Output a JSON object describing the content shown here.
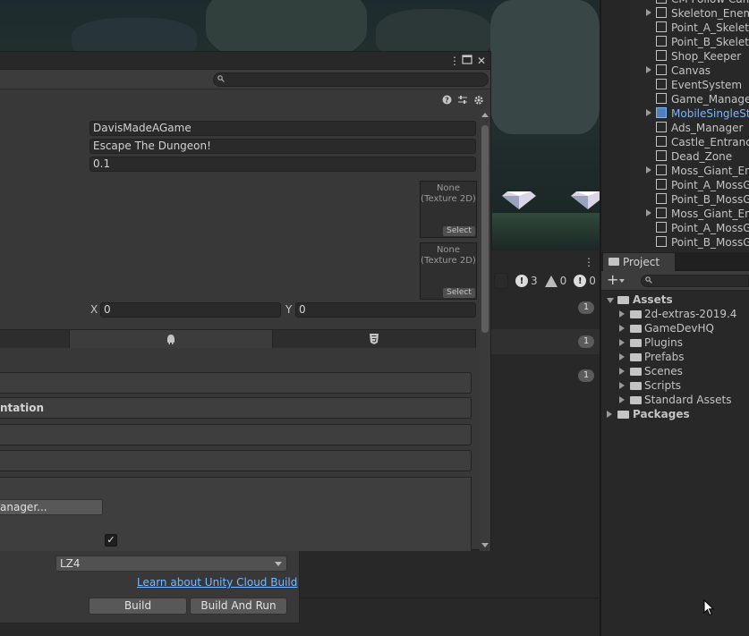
{
  "dialog": {
    "company_name": "DavisMadeAGame",
    "product_name": "Escape The Dungeon!",
    "version": "0.1",
    "texture_1": {
      "label": "None\n(Texture 2D)",
      "select": "Select"
    },
    "texture_2": {
      "label": "None\n(Texture 2D)",
      "select": "Select"
    },
    "hotspot_x_label": "X",
    "hotspot_x": "0",
    "hotspot_y_label": "Y",
    "hotspot_y": "0",
    "section_orientation": "ntation",
    "manager_button": "anager...",
    "checkbox_mark": "✓"
  },
  "build": {
    "compression": "LZ4",
    "cloud_link": "Learn about Unity Cloud Build",
    "build_label": "Build",
    "build_and_run_label": "Build And Run"
  },
  "console": {
    "error_count": "3",
    "warning_count": "0",
    "info_count": "0",
    "rows": [
      "1",
      "1",
      "1"
    ]
  },
  "hierarchy": {
    "items": [
      {
        "label": "CM Follow Cam",
        "fold": false,
        "prefab": false
      },
      {
        "label": "Skeleton_Enem",
        "fold": true,
        "prefab": false
      },
      {
        "label": "Point_A_Skeleto",
        "fold": false,
        "prefab": false
      },
      {
        "label": "Point_B_Skeleto",
        "fold": false,
        "prefab": false
      },
      {
        "label": "Shop_Keeper",
        "fold": false,
        "prefab": false
      },
      {
        "label": "Canvas",
        "fold": true,
        "prefab": false
      },
      {
        "label": "EventSystem",
        "fold": false,
        "prefab": false
      },
      {
        "label": "Game_Manager",
        "fold": false,
        "prefab": false
      },
      {
        "label": "MobileSingleSti",
        "fold": true,
        "prefab": true
      },
      {
        "label": "Ads_Manager",
        "fold": false,
        "prefab": false
      },
      {
        "label": "Castle_Entrance",
        "fold": false,
        "prefab": false
      },
      {
        "label": "Dead_Zone",
        "fold": false,
        "prefab": false
      },
      {
        "label": "Moss_Giant_Ene",
        "fold": true,
        "prefab": false
      },
      {
        "label": "Point_A_MossG",
        "fold": false,
        "prefab": false
      },
      {
        "label": "Point_B_MossG",
        "fold": false,
        "prefab": false
      },
      {
        "label": "Moss_Giant_Ene",
        "fold": true,
        "prefab": false
      },
      {
        "label": "Point_A_MossG",
        "fold": false,
        "prefab": false
      },
      {
        "label": "Point_B_MossG",
        "fold": false,
        "prefab": false
      }
    ]
  },
  "project": {
    "tab_label": "Project",
    "assets_label": "Assets",
    "folders": [
      "2d-extras-2019.4",
      "GameDevHQ",
      "Plugins",
      "Prefabs",
      "Scenes",
      "Scripts",
      "Standard Assets"
    ],
    "packages_label": "Packages"
  },
  "colors": {
    "accent_link": "#7ab8ff",
    "prefab_blue": "#7fb5f5",
    "panel_bg": "#383838",
    "dark_bg": "#282828"
  }
}
